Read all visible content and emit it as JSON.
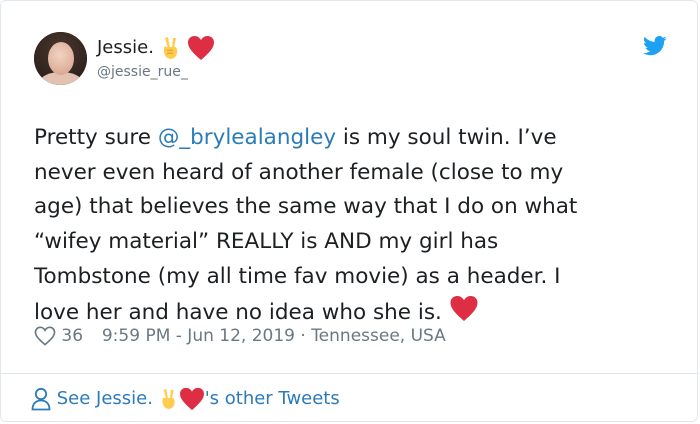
{
  "tweet": {
    "author": {
      "display_name": "Jessie.",
      "handle": "@jessie_rue_"
    },
    "text": {
      "line1_before": "Pretty sure ",
      "mention": "@_brylealangley",
      "line1_after": " is my soul twin. I’ve",
      "line2": "never even heard of another female (close to my",
      "line3": "age) that believes the same way that I do on what",
      "line4": "“wifey material” REALLY is AND my girl has",
      "line5": "Tombstone (my all time fav movie) as a header. I",
      "line6": "love her and have no idea who she is. "
    },
    "likes": "36",
    "timestamp": "9:59 PM - Jun 12, 2019",
    "separator": "·",
    "location": "Tennessee, USA",
    "footer": {
      "prefix": "See Jessie.",
      "suffix": "'s other Tweets"
    }
  },
  "colors": {
    "link": "#2b7bb9",
    "meta": "#697882",
    "heart": "#dd2e44",
    "twitter_blue": "#1da1f2"
  },
  "icons": [
    "victory-hand-emoji",
    "red-heart-emoji",
    "twitter-bird-icon",
    "heart-outline-icon",
    "person-icon"
  ]
}
